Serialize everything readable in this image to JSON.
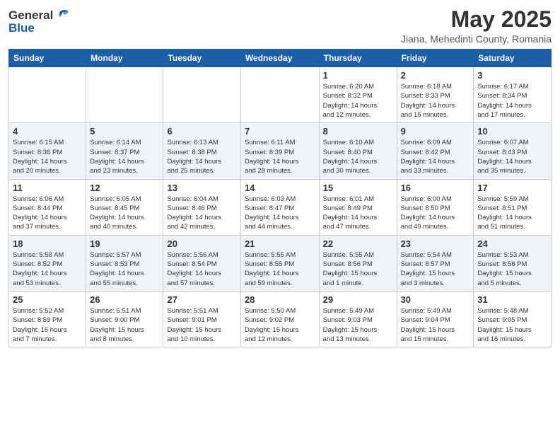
{
  "header": {
    "logo_line1": "General",
    "logo_line2": "Blue",
    "month": "May 2025",
    "location": "Jiana, Mehedinti County, Romania"
  },
  "weekdays": [
    "Sunday",
    "Monday",
    "Tuesday",
    "Wednesday",
    "Thursday",
    "Friday",
    "Saturday"
  ],
  "weeks": [
    [
      {
        "day": "",
        "info": ""
      },
      {
        "day": "",
        "info": ""
      },
      {
        "day": "",
        "info": ""
      },
      {
        "day": "",
        "info": ""
      },
      {
        "day": "1",
        "info": "Sunrise: 6:20 AM\nSunset: 8:32 PM\nDaylight: 14 hours\nand 12 minutes."
      },
      {
        "day": "2",
        "info": "Sunrise: 6:18 AM\nSunset: 8:33 PM\nDaylight: 14 hours\nand 15 minutes."
      },
      {
        "day": "3",
        "info": "Sunrise: 6:17 AM\nSunset: 8:34 PM\nDaylight: 14 hours\nand 17 minutes."
      }
    ],
    [
      {
        "day": "4",
        "info": "Sunrise: 6:15 AM\nSunset: 8:36 PM\nDaylight: 14 hours\nand 20 minutes."
      },
      {
        "day": "5",
        "info": "Sunrise: 6:14 AM\nSunset: 8:37 PM\nDaylight: 14 hours\nand 23 minutes."
      },
      {
        "day": "6",
        "info": "Sunrise: 6:13 AM\nSunset: 8:38 PM\nDaylight: 14 hours\nand 25 minutes."
      },
      {
        "day": "7",
        "info": "Sunrise: 6:11 AM\nSunset: 8:39 PM\nDaylight: 14 hours\nand 28 minutes."
      },
      {
        "day": "8",
        "info": "Sunrise: 6:10 AM\nSunset: 8:40 PM\nDaylight: 14 hours\nand 30 minutes."
      },
      {
        "day": "9",
        "info": "Sunrise: 6:09 AM\nSunset: 8:42 PM\nDaylight: 14 hours\nand 33 minutes."
      },
      {
        "day": "10",
        "info": "Sunrise: 6:07 AM\nSunset: 8:43 PM\nDaylight: 14 hours\nand 35 minutes."
      }
    ],
    [
      {
        "day": "11",
        "info": "Sunrise: 6:06 AM\nSunset: 8:44 PM\nDaylight: 14 hours\nand 37 minutes."
      },
      {
        "day": "12",
        "info": "Sunrise: 6:05 AM\nSunset: 8:45 PM\nDaylight: 14 hours\nand 40 minutes."
      },
      {
        "day": "13",
        "info": "Sunrise: 6:04 AM\nSunset: 8:46 PM\nDaylight: 14 hours\nand 42 minutes."
      },
      {
        "day": "14",
        "info": "Sunrise: 6:03 AM\nSunset: 8:47 PM\nDaylight: 14 hours\nand 44 minutes."
      },
      {
        "day": "15",
        "info": "Sunrise: 6:01 AM\nSunset: 8:49 PM\nDaylight: 14 hours\nand 47 minutes."
      },
      {
        "day": "16",
        "info": "Sunrise: 6:00 AM\nSunset: 8:50 PM\nDaylight: 14 hours\nand 49 minutes."
      },
      {
        "day": "17",
        "info": "Sunrise: 5:59 AM\nSunset: 8:51 PM\nDaylight: 14 hours\nand 51 minutes."
      }
    ],
    [
      {
        "day": "18",
        "info": "Sunrise: 5:58 AM\nSunset: 8:52 PM\nDaylight: 14 hours\nand 53 minutes."
      },
      {
        "day": "19",
        "info": "Sunrise: 5:57 AM\nSunset: 8:53 PM\nDaylight: 14 hours\nand 55 minutes."
      },
      {
        "day": "20",
        "info": "Sunrise: 5:56 AM\nSunset: 8:54 PM\nDaylight: 14 hours\nand 57 minutes."
      },
      {
        "day": "21",
        "info": "Sunrise: 5:55 AM\nSunset: 8:55 PM\nDaylight: 14 hours\nand 59 minutes."
      },
      {
        "day": "22",
        "info": "Sunrise: 5:55 AM\nSunset: 8:56 PM\nDaylight: 15 hours\nand 1 minute."
      },
      {
        "day": "23",
        "info": "Sunrise: 5:54 AM\nSunset: 8:57 PM\nDaylight: 15 hours\nand 3 minutes."
      },
      {
        "day": "24",
        "info": "Sunrise: 5:53 AM\nSunset: 8:58 PM\nDaylight: 15 hours\nand 5 minutes."
      }
    ],
    [
      {
        "day": "25",
        "info": "Sunrise: 5:52 AM\nSunset: 8:59 PM\nDaylight: 15 hours\nand 7 minutes."
      },
      {
        "day": "26",
        "info": "Sunrise: 5:51 AM\nSunset: 9:00 PM\nDaylight: 15 hours\nand 8 minutes."
      },
      {
        "day": "27",
        "info": "Sunrise: 5:51 AM\nSunset: 9:01 PM\nDaylight: 15 hours\nand 10 minutes."
      },
      {
        "day": "28",
        "info": "Sunrise: 5:50 AM\nSunset: 9:02 PM\nDaylight: 15 hours\nand 12 minutes."
      },
      {
        "day": "29",
        "info": "Sunrise: 5:49 AM\nSunset: 9:03 PM\nDaylight: 15 hours\nand 13 minutes."
      },
      {
        "day": "30",
        "info": "Sunrise: 5:49 AM\nSunset: 9:04 PM\nDaylight: 15 hours\nand 15 minutes."
      },
      {
        "day": "31",
        "info": "Sunrise: 5:48 AM\nSunset: 9:05 PM\nDaylight: 15 hours\nand 16 minutes."
      }
    ]
  ]
}
